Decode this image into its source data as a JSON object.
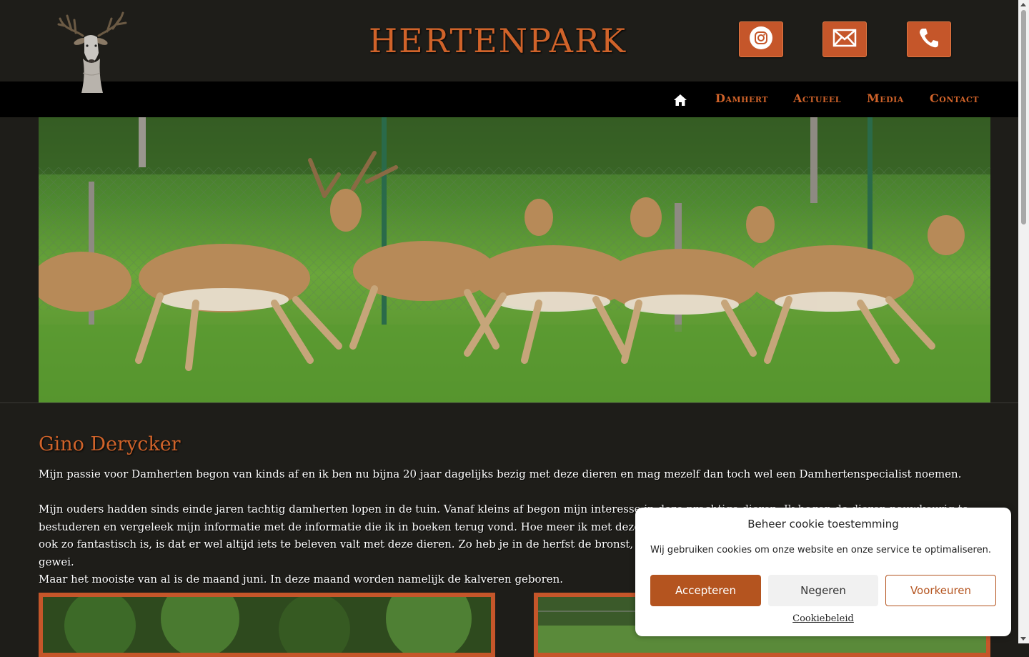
{
  "header": {
    "title": "HERTENPARK",
    "logo_icon": "deer-head-icon",
    "buttons": [
      {
        "icon": "instagram-icon"
      },
      {
        "icon": "mail-icon"
      },
      {
        "icon": "phone-icon"
      }
    ]
  },
  "nav": {
    "home_icon": "home-icon",
    "items": [
      {
        "label": "Damhert"
      },
      {
        "label": "Actueel"
      },
      {
        "label": "Media"
      },
      {
        "label": "Contact"
      }
    ]
  },
  "content": {
    "heading": "Gino Derycker",
    "para1": "Mijn passie voor Damherten begon van kinds af en ik ben nu bijna 20 jaar dagelijks  bezig met deze dieren en mag mezelf dan toch wel een Damhertenspecialist noemen.",
    "para2_lines": [
      "Mijn ouders hadden sinds einde jaren tachtig damherten lopen in de tuin. Vanaf kleins af begon mijn interesse in deze prachtige dieren. Ik begon de dieren nauwkeurig te",
      "bestuderen en vergeleek mijn informatie met de informatie die ik in boeken terug vond. Hoe meer ik met deze dieren bezig was, hoe meer ik er van leerde. Wat deze dieren",
      "ook zo fantastisch is, is dat er wel altijd iets te beleven valt met deze dieren. Zo heb je in de herfst de bronst, in het voorjaar het verliezen en terug aangroeien van het gewei.",
      "Maar het mooiste van al is de maand juni. In deze maand worden namelijk de kalveren geboren."
    ]
  },
  "cookie": {
    "title": "Beheer cookie toestemming",
    "text": "Wij gebruiken cookies om onze website en onze service te optimaliseren.",
    "accept": "Accepteren",
    "deny": "Negeren",
    "prefs": "Voorkeuren",
    "policy": "Cookiebeleid"
  },
  "colors": {
    "accent": "#d0632a",
    "button_bg": "#c5562a",
    "page_bg": "#1e1d19",
    "nav_bg": "#000000"
  }
}
